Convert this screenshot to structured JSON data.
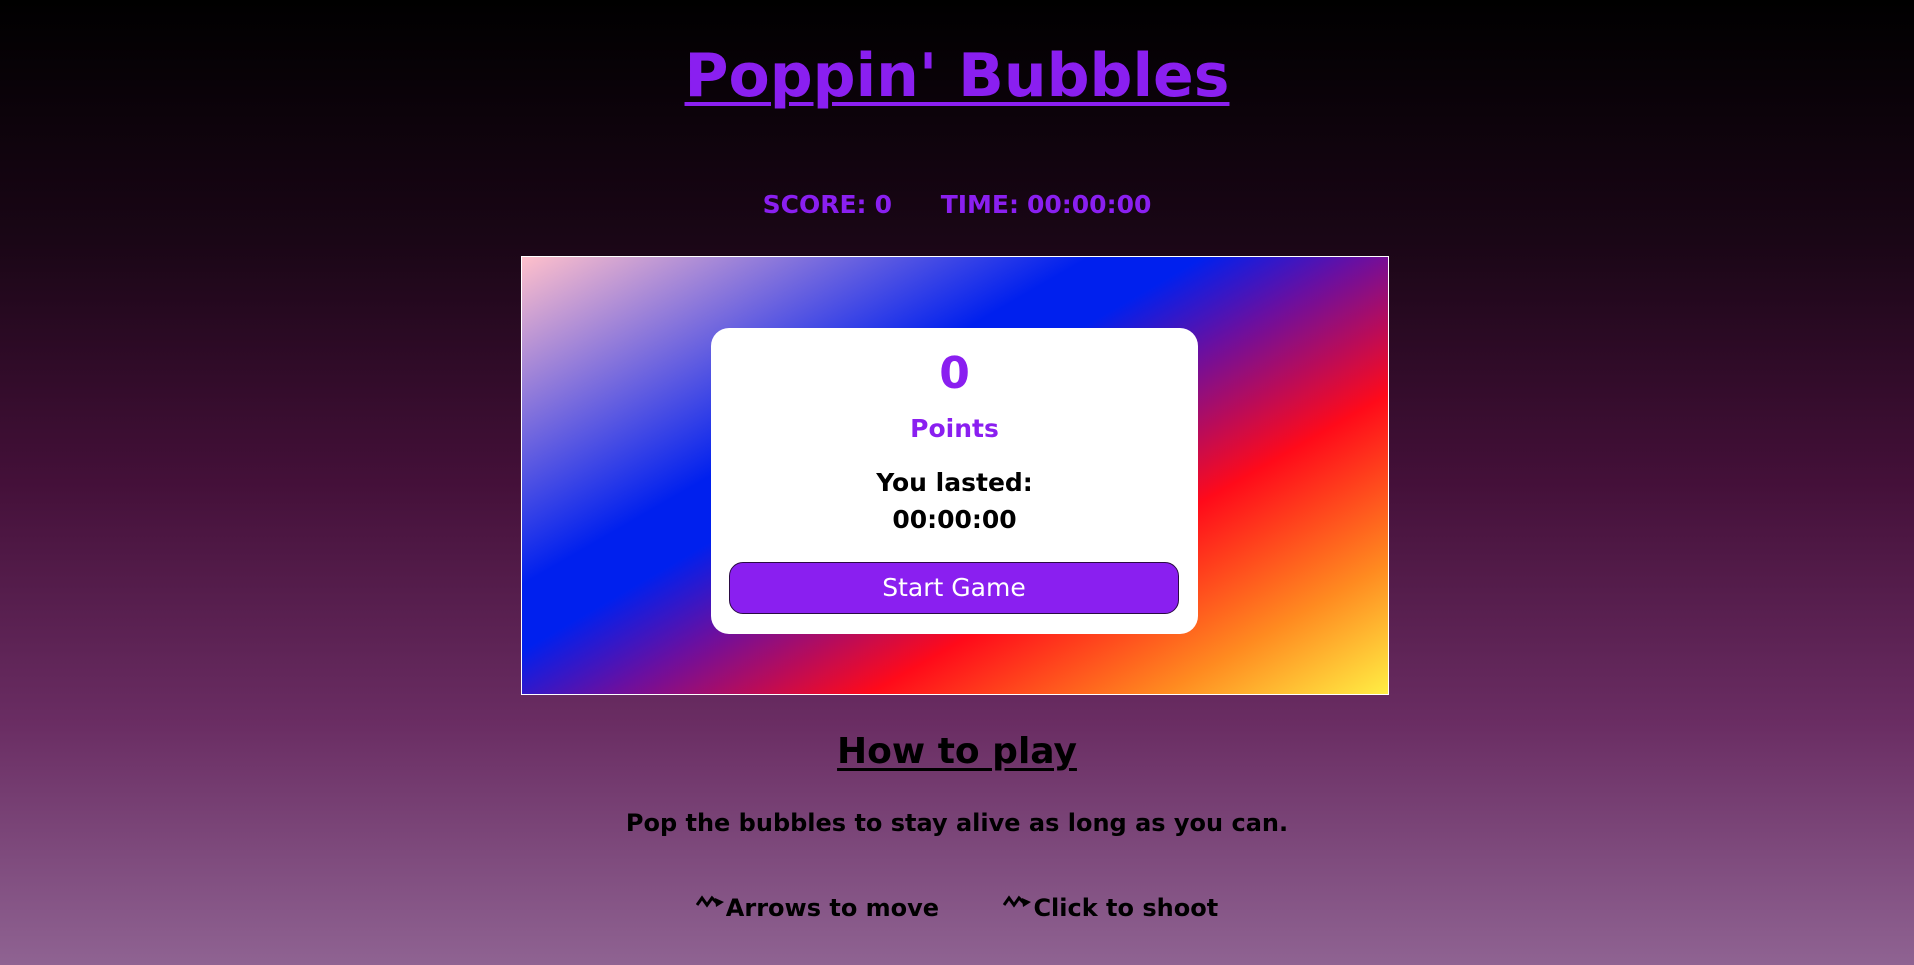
{
  "title": "Poppin' Bubbles",
  "stats": {
    "score_label": "SCORE:",
    "score_value": "0",
    "time_label": "TIME:",
    "time_value": "00:00:00"
  },
  "modal": {
    "score": "0",
    "points_label": "Points",
    "lasted_label": "You lasted:",
    "lasted_time": "00:00:00",
    "start_button": "Start Game"
  },
  "how_to_play": {
    "title": "How to play",
    "description": "Pop the bubbles to stay alive as long as you can.",
    "controls": [
      {
        "icon": "double-arrow-icon",
        "text": "Arrows to move"
      },
      {
        "icon": "double-arrow-icon",
        "text": "Click to shoot"
      }
    ]
  },
  "colors": {
    "accent": "#8a1ff0",
    "text_dark": "#000000",
    "modal_bg": "#ffffff"
  }
}
